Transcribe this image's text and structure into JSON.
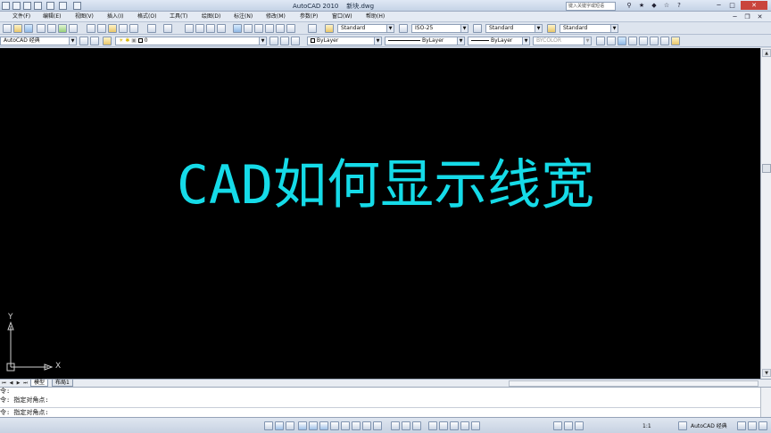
{
  "window": {
    "app_title": "AutoCAD 2010",
    "file_name": "新块.dwg",
    "search_placeholder": "键入关键字或短语"
  },
  "menu": {
    "items": [
      "文件(F)",
      "编辑(E)",
      "视图(V)",
      "插入(I)",
      "格式(O)",
      "工具(T)",
      "绘图(D)",
      "标注(N)",
      "修改(M)",
      "参数(P)",
      "窗口(W)",
      "帮助(H)"
    ]
  },
  "toolbar1": {
    "text_style": "Standard",
    "dim_style": "ISO-25",
    "table_style": "Standard",
    "multileader_style": "Standard"
  },
  "toolbar2": {
    "workspace": "AutoCAD 经典",
    "layer": "0",
    "color": "ByLayer",
    "linetype": "ByLayer",
    "lineweight": "ByLayer",
    "plot_style": "BYCOLOR"
  },
  "canvas": {
    "overlay_text": "CAD如何显示线宽",
    "overlay_color": "#15dbe8",
    "background": "#000000",
    "ucs_x_label": "X",
    "ucs_y_label": "Y"
  },
  "tabs": {
    "items": [
      "模型",
      "布局1"
    ],
    "active": "模型"
  },
  "command": {
    "lines": [
      "令:",
      "令: 指定对角点:",
      "令: 指定对角点:"
    ]
  },
  "statusbar": {
    "scale": "1:1",
    "workspace": "AutoCAD 经典"
  }
}
